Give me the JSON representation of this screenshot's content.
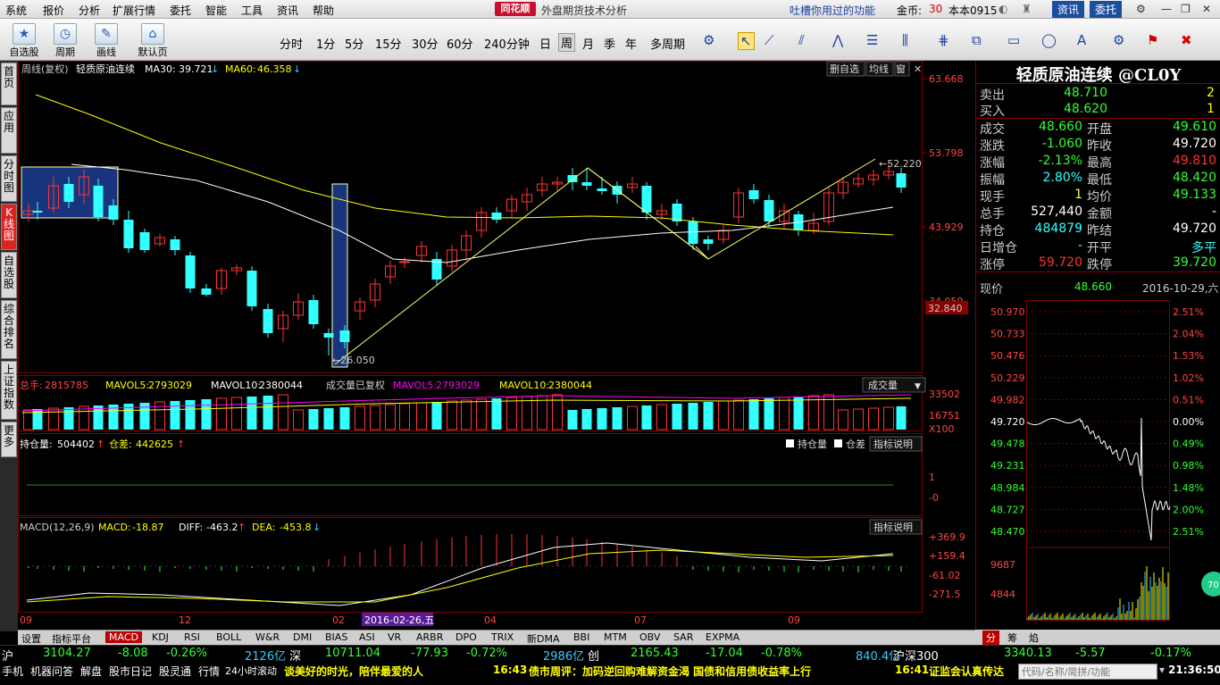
{
  "menu": {
    "items": [
      "系统",
      "报价",
      "分析",
      "扩展行情",
      "委托",
      "智能",
      "工具",
      "资讯",
      "帮助"
    ],
    "logo": "同花顺",
    "subtitle": "外盘期货技术分析",
    "promo": "吐槽你用过的功能",
    "coins_label": "金币:",
    "coins": "30",
    "version": "本本0915",
    "news_btn": "资讯",
    "trade_btn": "委托"
  },
  "toolbar": {
    "big": [
      {
        "icon": "star-icon",
        "label": "自选股"
      },
      {
        "icon": "clock-icon",
        "label": "周期"
      },
      {
        "icon": "pencil-icon",
        "label": "画线"
      },
      {
        "icon": "home-icon",
        "label": "默认页"
      }
    ],
    "periods": [
      "分时",
      "1分",
      "5分",
      "15分",
      "30分",
      "60分",
      "240分钟",
      "日",
      "周",
      "月",
      "季",
      "年",
      "多周期"
    ],
    "active_period": "周"
  },
  "left_tabs": [
    "首页",
    "应用",
    "分时图",
    "K线图",
    "自选股",
    "综合排名",
    "上证指数",
    "更多"
  ],
  "active_left_tab": "K线图",
  "kline": {
    "header_prefix": "周线(复权)",
    "name": "轻质原油连续",
    "ma30_label": "MA30:",
    "ma30": "39.721",
    "ma60_label": "MA60:",
    "ma60": "46.358",
    "btns": [
      "删自选",
      "均线",
      "窗"
    ],
    "price_axis": [
      "63.668",
      "53.798",
      "43.929",
      "34.059",
      "32.840"
    ],
    "high_mark": "52.220",
    "low_mark": "26.050"
  },
  "volume": {
    "total_label": "总手:",
    "total": "2815785",
    "mavol5_label": "MAVOL5:",
    "mavol5": "2793029",
    "mavol10_label": "MAVOL10:",
    "mavol10": "2380044",
    "adj_label": "成交量已复权",
    "dropdown": "成交量",
    "axis": [
      "33502",
      "16751",
      "X100"
    ]
  },
  "oi": {
    "label": "持仓量:",
    "value": "504402",
    "diff_label": "仓差:",
    "diff": "442625",
    "legend1": "持仓量",
    "legend2": "仓差",
    "help": "指标说明",
    "axis": [
      "1",
      "0",
      "-0"
    ]
  },
  "macd": {
    "label": "MACD(12,26,9)",
    "macd_label": "MACD:",
    "macd": "-18.87",
    "diff_label": "DIFF:",
    "diff": "-463.2",
    "dea_label": "DEA:",
    "dea": "-453.8",
    "help": "指标说明",
    "axis": [
      "+369.9",
      "+159.4",
      "-61.02",
      "-271.5"
    ]
  },
  "xaxis": {
    "labels": [
      "09",
      "12",
      "02",
      "04",
      "07",
      "09"
    ],
    "cursor_date": "2016-02-26,五"
  },
  "bottom_tabs": [
    "设置",
    "指标平台",
    "MACD",
    "KDJ",
    "RSI",
    "BOLL",
    "W&R",
    "DMI",
    "BIAS",
    "ASI",
    "VR",
    "ARBR",
    "DPO",
    "TRIX",
    "新DMA",
    "BBI",
    "MTM",
    "OBV",
    "SAR",
    "EXPMA"
  ],
  "active_bottom_tab": "MACD",
  "quote": {
    "title": "轻质原油连续 @CL0Y",
    "sell": {
      "label": "卖出",
      "price": "48.710",
      "vol": "2"
    },
    "buy": {
      "label": "买入",
      "price": "48.620",
      "vol": "1"
    },
    "rows": [
      {
        "l1": "成交",
        "v1": "48.660",
        "l2": "开盘",
        "v2": "49.610",
        "c1": "#33ff33",
        "c2": "#33ff33"
      },
      {
        "l1": "涨跌",
        "v1": "-1.060",
        "l2": "昨收",
        "v2": "49.720",
        "c1": "#33ff33",
        "c2": "#ffffff"
      },
      {
        "l1": "涨幅",
        "v1": "-2.13%",
        "l2": "最高",
        "v2": "49.810",
        "c1": "#33ff33",
        "c2": "#ff3333"
      },
      {
        "l1": "振幅",
        "v1": "2.80%",
        "l2": "最低",
        "v2": "48.420",
        "c1": "#33ffff",
        "c2": "#33ff33"
      },
      {
        "l1": "现手",
        "v1": "1",
        "l2": "均价",
        "v2": "49.133",
        "c1": "#ffff33",
        "c2": "#33ff33"
      },
      {
        "l1": "总手",
        "v1": "527,440",
        "l2": "金额",
        "v2": "-",
        "c1": "#ffffff",
        "c2": "#ffffff"
      },
      {
        "l1": "持仓",
        "v1": "484879",
        "l2": "昨结",
        "v2": "49.720",
        "c1": "#33ffff",
        "c2": "#ffffff"
      },
      {
        "l1": "日增仓",
        "v1": "-",
        "l2": "开平",
        "v2": "多平",
        "c1": "#33ffff",
        "c2": "#33ffff"
      },
      {
        "l1": "涨停",
        "v1": "59.720",
        "l2": "跌停",
        "v2": "39.720",
        "c1": "#ff3333",
        "c2": "#33ff33"
      }
    ],
    "now_label": "现价",
    "now": "48.660",
    "now_date": "2016-10-29,六",
    "mini_left": [
      "50.970",
      "50.733",
      "50.476",
      "50.229",
      "49.982",
      "49.720",
      "49.478",
      "49.231",
      "48.984",
      "48.727",
      "48.470",
      "9687",
      "4844"
    ],
    "mini_right": [
      "2.51%",
      "2.04%",
      "1.53%",
      "1.02%",
      "0.51%",
      "0.00%",
      "0.49%",
      "0.98%",
      "1.48%",
      "2.00%",
      "2.51%"
    ],
    "badge": "70",
    "tabs": [
      "分",
      "筹",
      "焰"
    ]
  },
  "ticker": {
    "sh_label": "沪",
    "sh": "3104.27",
    "sh_chg": "-8.08",
    "sh_pct": "-0.26%",
    "sh_amt": "2126亿",
    "sz_label": "深",
    "sz": "10711.04",
    "sz_chg": "-77.93",
    "sz_pct": "-0.72%",
    "sz_amt": "2986亿",
    "cy_label": "创",
    "cy": "2165.43",
    "cy_chg": "-17.04",
    "cy_pct": "-0.78%",
    "cy_amt": "840.4亿",
    "hs_label": "沪深300",
    "hs": "3340.13",
    "hs_chg": "-5.57",
    "hs_pct": "-0.17%"
  },
  "status": {
    "items": [
      "手机",
      "机器问答",
      "解盘",
      "股市日记",
      "股灵通",
      "行情",
      "24小时滚动"
    ],
    "news1": "谈美好的时光，陪伴最爱的人",
    "news2_time": "16:43",
    "news2": "债市周评：加码逆回购难解资金渴 国债和信用债收益率上行",
    "news3_time": "16:41",
    "news3": "证监会认真传达",
    "search_placeholder": "代码/名称/简拼/功能",
    "clock": "21:36:50"
  },
  "colors": {
    "up": "#ff3333",
    "down": "#33ffff",
    "ma30": "#ffffff",
    "ma60": "#ffff00",
    "grid": "#800000",
    "macd_up": "#ff3333",
    "macd_down": "#33ff33"
  }
}
